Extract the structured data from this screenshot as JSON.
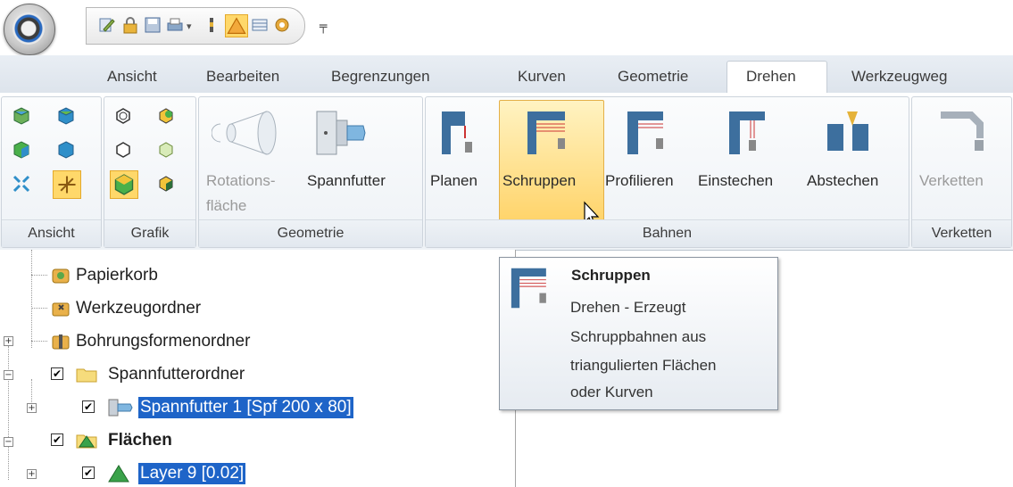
{
  "ribbon_tabs": [
    "Ansicht",
    "Bearbeiten",
    "Begrenzungen",
    "Kurven",
    "Geometrie",
    "Drehen",
    "Werkzeugweg"
  ],
  "active_tab": "Drehen",
  "groups": {
    "ansicht": {
      "label": "Ansicht"
    },
    "grafik": {
      "label": "Grafik"
    },
    "geometrie": {
      "label": "Geometrie",
      "buttons": {
        "rotation_line1": "Rotations-",
        "rotation_line2": "fläche",
        "spannfutter": "Spannfutter"
      }
    },
    "bahnen": {
      "label": "Bahnen",
      "buttons": {
        "planen": "Planen",
        "schruppen": "Schruppen",
        "profilieren": "Profilieren",
        "einstechen": "Einstechen",
        "abstechen": "Abstechen"
      }
    },
    "verketten": {
      "label": "Verketten",
      "buttons": {
        "verketten": "Verketten"
      }
    }
  },
  "tree": {
    "items": [
      {
        "label": "Papierkorb"
      },
      {
        "label": "Werkzeugordner"
      },
      {
        "label": "Bohrungsformenordner"
      },
      {
        "label": "Spannfutterordner"
      },
      {
        "label": "Spannfutter 1 [Spf 200 x 80]"
      },
      {
        "label": "Flächen"
      },
      {
        "label": "Layer 9 [0.02]"
      }
    ]
  },
  "tooltip": {
    "title": "Schruppen",
    "lines": [
      "Drehen - Erzeugt",
      "Schruppbahnen aus",
      "triangulierten Flächen",
      "oder Kurven"
    ]
  },
  "colors": {
    "accent": "#1e64c8",
    "highlight": "#ffd86a",
    "tab_bg": "#dde4ec"
  }
}
